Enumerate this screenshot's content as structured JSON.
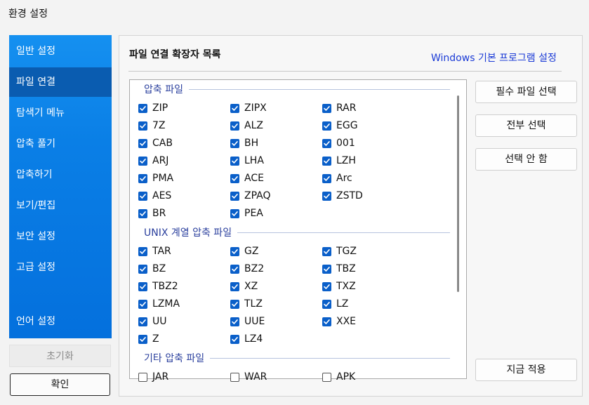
{
  "window": {
    "title": "환경 설정"
  },
  "sidebar": {
    "items": [
      {
        "label": "일반 설정"
      },
      {
        "label": "파일 연결"
      },
      {
        "label": "탐색기 메뉴"
      },
      {
        "label": "압축 풀기"
      },
      {
        "label": "압축하기"
      },
      {
        "label": "보기/편집"
      },
      {
        "label": "보안 설정"
      },
      {
        "label": "고급 설정"
      },
      {
        "label": "언어 설정"
      }
    ],
    "active_index": 1
  },
  "footer": {
    "reset_label": "초기화",
    "ok_label": "확인"
  },
  "panel": {
    "title": "파일 연결 확장자 목록",
    "windows_default_link": "Windows 기본 프로그램 설정"
  },
  "groups": [
    {
      "header": "압축 파일",
      "items": [
        {
          "label": "ZIP",
          "checked": true
        },
        {
          "label": "ZIPX",
          "checked": true
        },
        {
          "label": "RAR",
          "checked": true
        },
        {
          "label": "7Z",
          "checked": true
        },
        {
          "label": "ALZ",
          "checked": true
        },
        {
          "label": "EGG",
          "checked": true
        },
        {
          "label": "CAB",
          "checked": true
        },
        {
          "label": "BH",
          "checked": true
        },
        {
          "label": "001",
          "checked": true
        },
        {
          "label": "ARJ",
          "checked": true
        },
        {
          "label": "LHA",
          "checked": true
        },
        {
          "label": "LZH",
          "checked": true
        },
        {
          "label": "PMA",
          "checked": true
        },
        {
          "label": "ACE",
          "checked": true
        },
        {
          "label": "Arc",
          "checked": true
        },
        {
          "label": "AES",
          "checked": true
        },
        {
          "label": "ZPAQ",
          "checked": true
        },
        {
          "label": "ZSTD",
          "checked": true
        },
        {
          "label": "BR",
          "checked": true
        },
        {
          "label": "PEA",
          "checked": true
        }
      ]
    },
    {
      "header": "UNIX 계열 압축 파일",
      "items": [
        {
          "label": "TAR",
          "checked": true
        },
        {
          "label": "GZ",
          "checked": true
        },
        {
          "label": "TGZ",
          "checked": true
        },
        {
          "label": "BZ",
          "checked": true
        },
        {
          "label": "BZ2",
          "checked": true
        },
        {
          "label": "TBZ",
          "checked": true
        },
        {
          "label": "TBZ2",
          "checked": true
        },
        {
          "label": "XZ",
          "checked": true
        },
        {
          "label": "TXZ",
          "checked": true
        },
        {
          "label": "LZMA",
          "checked": true
        },
        {
          "label": "TLZ",
          "checked": true
        },
        {
          "label": "LZ",
          "checked": true
        },
        {
          "label": "UU",
          "checked": true
        },
        {
          "label": "UUE",
          "checked": true
        },
        {
          "label": "XXE",
          "checked": true
        },
        {
          "label": "Z",
          "checked": true
        },
        {
          "label": "LZ4",
          "checked": true
        }
      ]
    },
    {
      "header": "기타 압축 파일",
      "items": [
        {
          "label": "JAR",
          "checked": false
        },
        {
          "label": "WAR",
          "checked": false
        },
        {
          "label": "APK",
          "checked": false
        }
      ]
    }
  ],
  "actions": {
    "select_required": "필수 파일 선택",
    "select_all": "전부 선택",
    "select_none": "선택 안 함",
    "apply_now": "지금 적용"
  },
  "colors": {
    "accent": "#0a5fc9",
    "sidebar": "#0a7fe6",
    "link": "#1a3ad6"
  }
}
